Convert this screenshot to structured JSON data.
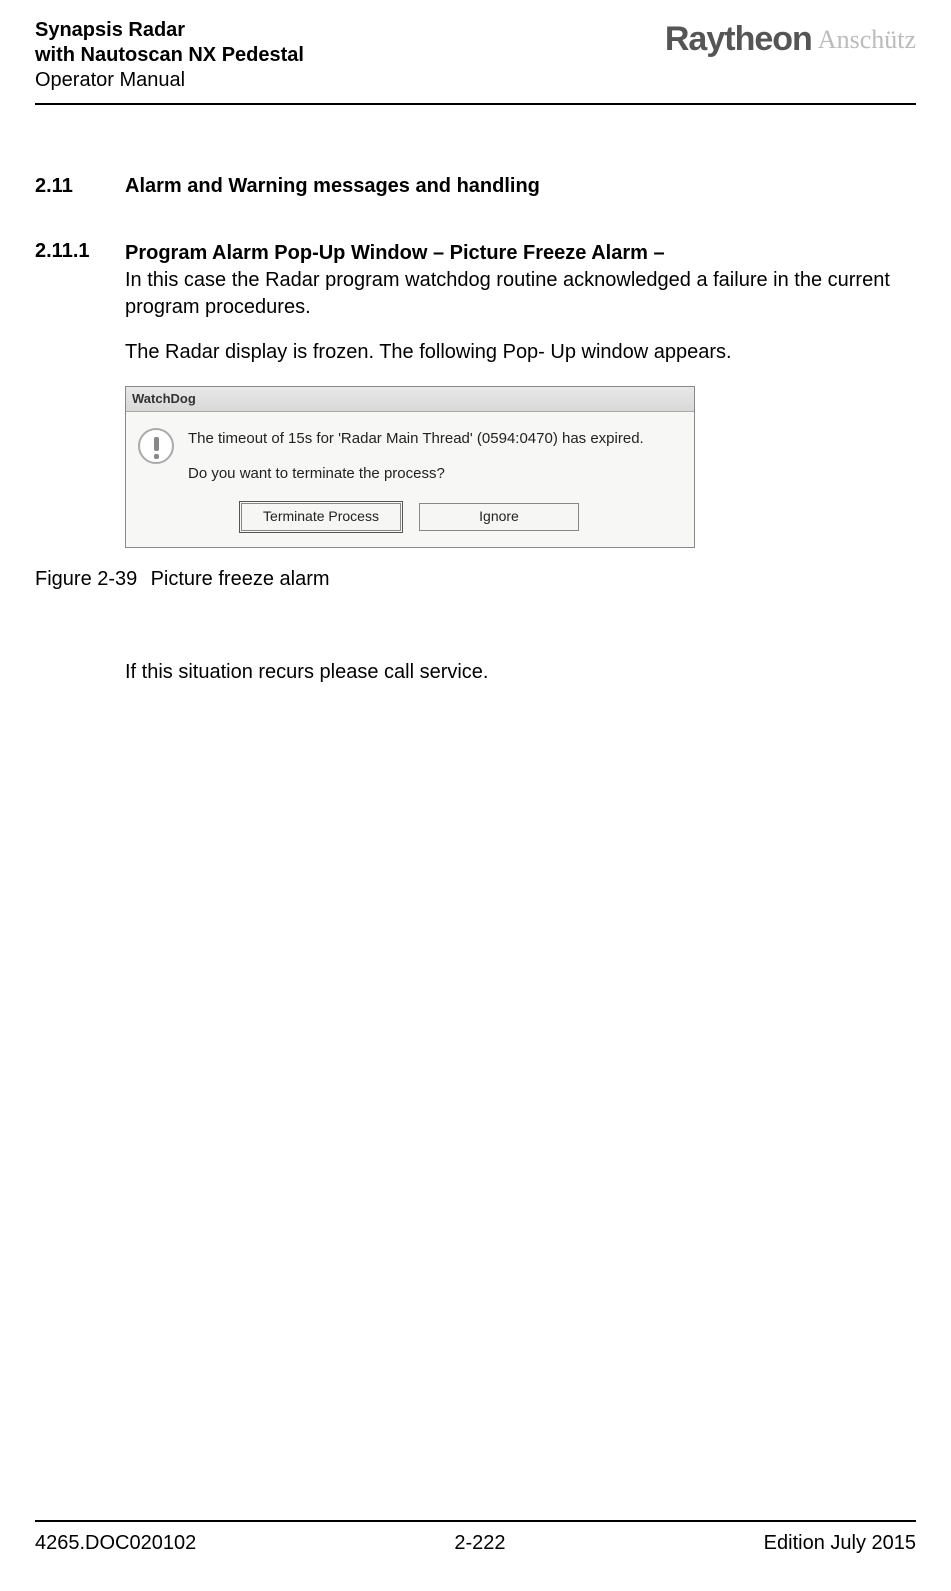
{
  "header": {
    "line1": "Synapsis Radar",
    "line2": "with Nautoscan NX Pedestal",
    "line3": "Operator Manual",
    "logo_primary": "Raytheon",
    "logo_secondary": "Anschütz"
  },
  "section": {
    "number": "2.11",
    "title": "Alarm and Warning messages and handling"
  },
  "subsection": {
    "number": "2.11.1",
    "title": "Program Alarm Pop-Up Window – Picture Freeze Alarm –",
    "para1": "In this case the Radar program watchdog routine acknowledged a failure in the current program procedures.",
    "para2": "The Radar display is frozen. The following Pop- Up window appears."
  },
  "screenshot": {
    "window_title": "WatchDog",
    "line1": "The timeout of 15s for 'Radar Main Thread' (0594:0470) has expired.",
    "line2": "Do you want to terminate the process?",
    "button_terminate": "Terminate Process",
    "button_ignore": "Ignore"
  },
  "figure": {
    "number": "Figure 2-39",
    "caption": "Picture freeze alarm"
  },
  "after_text": "If this situation recurs please call service.",
  "footer": {
    "doc": "4265.DOC020102",
    "page": "2-222",
    "edition": "Edition July 2015"
  }
}
